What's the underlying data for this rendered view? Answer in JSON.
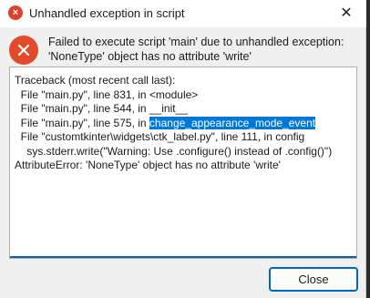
{
  "window": {
    "title": "Unhandled exception in script",
    "close_glyph": "✕",
    "title_icon_glyph": "×"
  },
  "message": {
    "line1": "Failed to execute script 'main' due to unhandled exception:",
    "line2": "'NoneType' object has no attribute 'write'"
  },
  "traceback": {
    "header": "Traceback (most recent call last):",
    "line1": "  File \"main.py\", line 831, in <module>",
    "line2": "  File \"main.py\", line 544, in __init__",
    "line3_prefix": "  File \"main.py\", line 575, in ",
    "line3_selected": "change_appearance_mode_event",
    "line4": "  File \"customtkinter\\widgets\\ctk_label.py\", line 111, in config",
    "line5": "    sys.stderr.write(\"Warning: Use .configure() instead of .config()\")",
    "line6": "AttributeError: 'NoneType' object has no attribute 'write'"
  },
  "buttons": {
    "close_label": "Close"
  },
  "colors": {
    "error": "#e14b2c",
    "accent": "#0067c0",
    "selection": "#0078d7"
  }
}
